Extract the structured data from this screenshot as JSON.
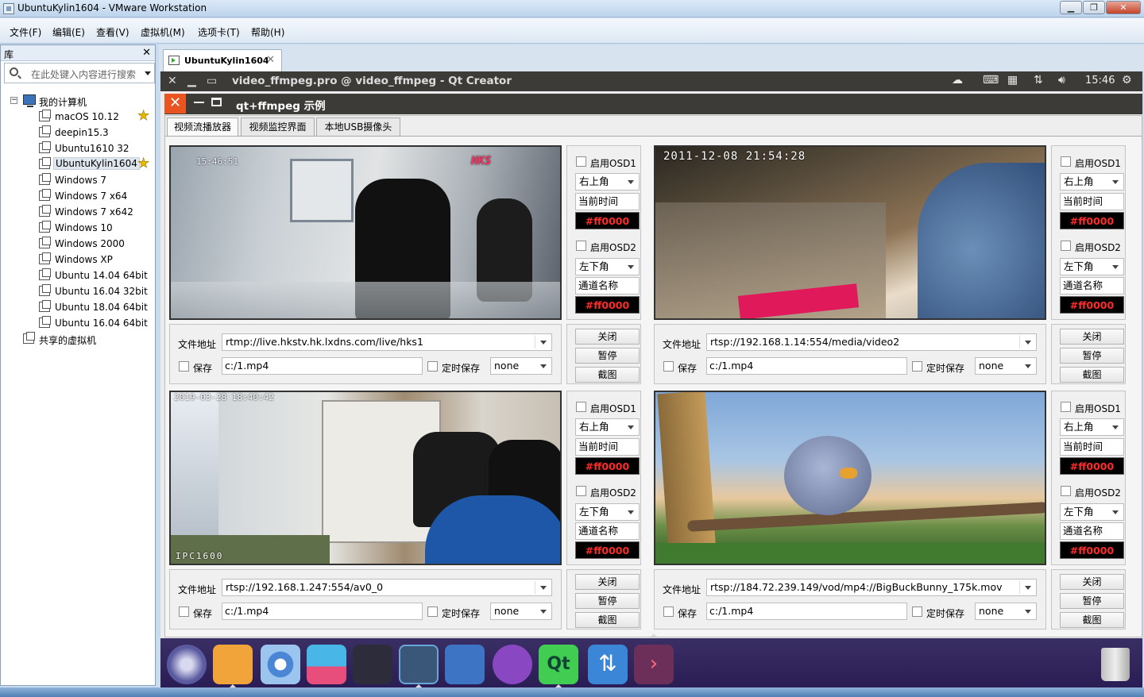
{
  "window": {
    "title": "UbuntuKylin1604 - VMware Workstation"
  },
  "menu": [
    "文件(F)",
    "编辑(E)",
    "查看(V)",
    "虚拟机(M)",
    "选项卡(T)",
    "帮助(H)"
  ],
  "library": {
    "header": "库",
    "close": "✕",
    "search_placeholder": "在此处键入内容进行搜索",
    "root": "我的计算机",
    "items": [
      "macOS 10.12",
      "deepin15.3",
      "Ubuntu1610 32",
      "UbuntuKylin1604",
      "Windows 7",
      "Windows 7 x64",
      "Windows 7 x642",
      "Windows 10",
      "Windows 2000",
      "Windows XP",
      "Ubuntu 14.04 64bit",
      "Ubuntu 16.04 32bit",
      "Ubuntu 18.04 64bit",
      "Ubuntu 16.04 64bit"
    ],
    "shared": "共享的虚拟机",
    "selected": "UbuntuKylin1604",
    "starred": [
      "macOS 10.12",
      "UbuntuKylin1604"
    ]
  },
  "vm_tab": {
    "label": "UbuntuKylin1604",
    "close": "✕"
  },
  "guest": {
    "top_title": "video_ffmpeg.pro @ video_ffmpeg - Qt Creator",
    "clock": "15:46",
    "app_title": "qt+ffmpeg 示例",
    "tabs": [
      "视频流播放器",
      "视频监控界面",
      "本地USB摄像头"
    ],
    "active_tab": 0,
    "panels": [
      {
        "osd_text": "",
        "url": "rtmp://live.hkstv.hk.lxdns.com/live/hks1",
        "logo": "HKS",
        "corner_text": "15:46:51"
      },
      {
        "osd_text": "2011-12-08  21:54:28",
        "url": "rtsp://192.168.1.14:554/media/video2",
        "logo": "",
        "corner_text": ""
      },
      {
        "osd_text": "2019-03-28 18:40:42",
        "url": "rtsp://192.168.1.247:554/av0_0",
        "logo": "",
        "corner_text": "IPC1600"
      },
      {
        "osd_text": "",
        "url": "rtsp://184.72.239.149/vod/mp4://BigBuckBunny_175k.mov",
        "logo": "",
        "corner_text": ""
      }
    ],
    "controls": {
      "osd1": "启用OSD1",
      "osd2": "启用OSD2",
      "pos1": "右上角",
      "pos2": "左下角",
      "text1": "当前时间",
      "text2": "通道名称",
      "color": "#ff0000",
      "close_btn": "关闭",
      "pause_btn": "暂停",
      "snap_btn": "截图",
      "file_label": "文件地址",
      "save_label": "保存",
      "save_path": "c:/1.mp4",
      "timed_save": "定时保存",
      "timed_value": "none"
    }
  },
  "colors": {
    "accent": "#e95420",
    "panel_bg": "#3c3b37",
    "dock": "#2a1d55"
  }
}
